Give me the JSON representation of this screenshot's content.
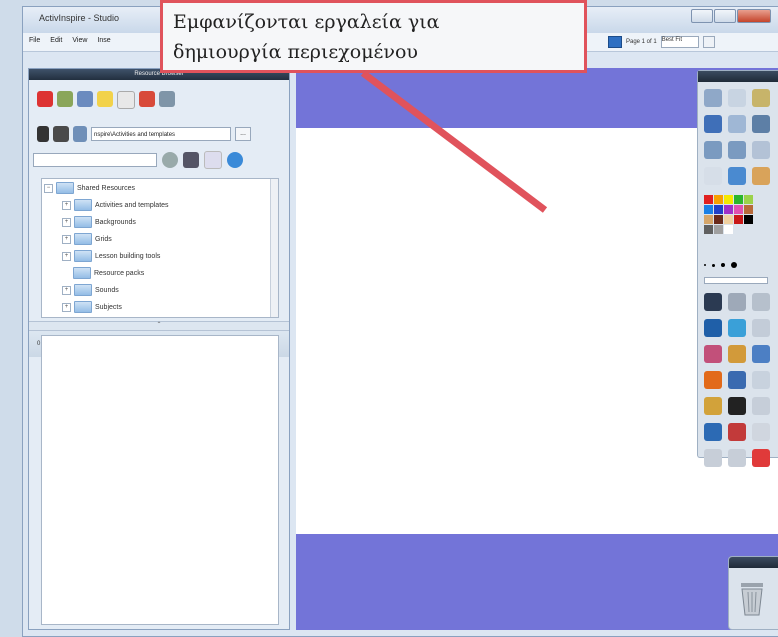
{
  "window": {
    "title": "ActivInspire - Studio"
  },
  "menubar": {
    "items": [
      "File",
      "Edit",
      "View",
      "Inse"
    ],
    "page_info": "Page 1 of 1",
    "page_select": "Best Fit"
  },
  "resource_browser": {
    "title": "Resource Browser",
    "path": "nspire\\Activities and templates",
    "browse_button": "...",
    "tree": {
      "root": "Shared Resources",
      "children": [
        {
          "label": "Activities and templates",
          "expandable": true
        },
        {
          "label": "Backgrounds",
          "expandable": true
        },
        {
          "label": "Grids",
          "expandable": true
        },
        {
          "label": "Lesson building tools",
          "expandable": true
        },
        {
          "label": "Resource packs",
          "expandable": false
        },
        {
          "label": "Sounds",
          "expandable": true
        },
        {
          "label": "Subjects",
          "expandable": true
        }
      ]
    },
    "item_count": "0 items"
  },
  "callout": {
    "line1": "Εμφανίζονται εργαλεία για",
    "line2": "δημιουργία περιεχομένου"
  },
  "colors": {
    "page_band": "#7374d8",
    "callout_border": "#e0535c",
    "arrow": "#e0535c"
  },
  "palette": [
    "#e02020",
    "#f7a000",
    "#f5e800",
    "#2bb52b",
    "#9bd24a",
    "#1a80e6",
    "#2140c8",
    "#a030c8",
    "#e050b0",
    "#b86a3a",
    "#d6a66a",
    "#6a2a1a",
    "#f0d0a0",
    "#c81818",
    "#000000",
    "#606060",
    "#a0a0a0",
    "#ffffff"
  ]
}
